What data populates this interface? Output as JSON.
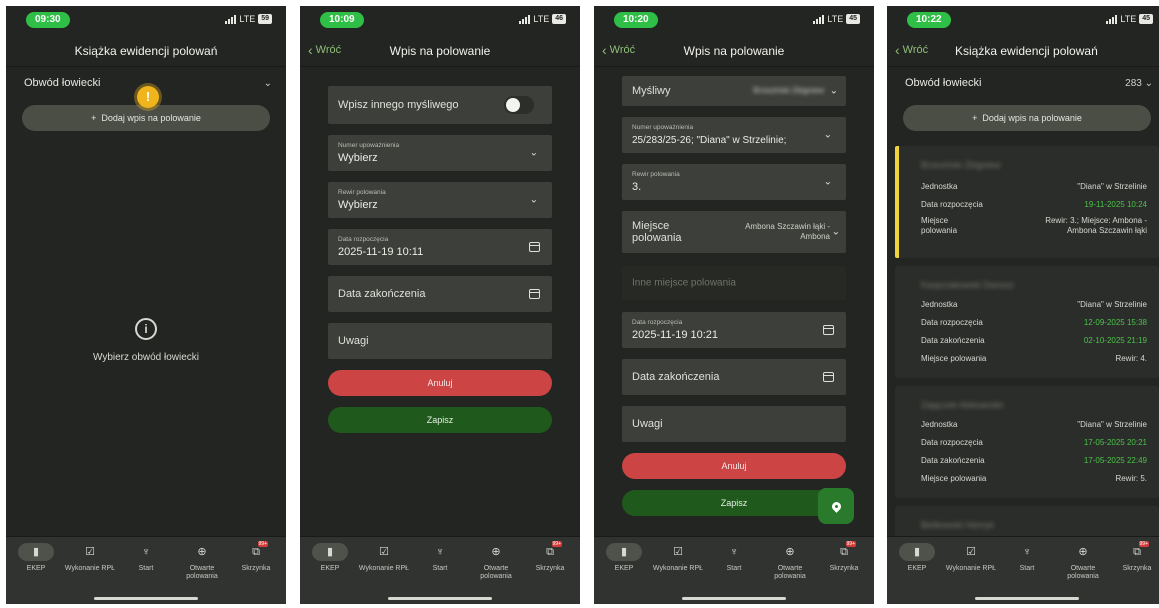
{
  "status": {
    "times": [
      "09:30",
      "10:09",
      "10:20",
      "10:22"
    ],
    "network": "LTE",
    "battery": [
      "59",
      "46",
      "45",
      "45"
    ]
  },
  "screen1": {
    "title": "Książka ewidencji polowań",
    "district_label": "Obwód łowiecki",
    "add_button": "Dodaj wpis na polowanie",
    "empty_text": "Wybierz obwód łowiecki"
  },
  "screen2": {
    "back_label": "Wróć",
    "title": "Wpis na polowanie",
    "other_hunter_label": "Wpisz innego myśliwego",
    "permit_label": "Numer upoważnienia",
    "permit_value": "Wybierz",
    "district_label": "Rewir polowania",
    "district_value": "Wybierz",
    "start_label": "Data rozpoczęcia",
    "start_value": "2025-11-19 10:11",
    "end_placeholder": "Data zakończenia",
    "notes_placeholder": "Uwagi",
    "cancel": "Anuluj",
    "save": "Zapisz"
  },
  "screen3": {
    "back_label": "Wróć",
    "title": "Wpis na polowanie",
    "hunter_label": "Myśliwy",
    "hunter_value": "Brzeziński Zbigniew",
    "permit_label": "Numer upoważnienia",
    "permit_value": "25/283/25-26; \"Diana\" w Strzelinie;",
    "district_label": "Rewir polowania",
    "district_value": "3.",
    "place_label": "Miejsce polowania",
    "place_value": "Ambona Szczawin łąki - Ambona",
    "other_place_placeholder": "Inne miejsce polowania",
    "start_label": "Data rozpoczęcia",
    "start_value": "2025-11-19 10:21",
    "end_placeholder": "Data zakończenia",
    "notes_placeholder": "Uwagi",
    "cancel": "Anuluj",
    "save": "Zapisz"
  },
  "screen4": {
    "back_label": "Wróć",
    "title": "Książka ewidencji polowań",
    "district_label": "Obwód łowiecki",
    "district_value": "283",
    "add_button": "Dodaj wpis na polowanie",
    "cards": [
      {
        "name": "Brzeziński Zbigniew",
        "unit_label": "Jednostka",
        "unit_value": "\"Diana\" w Strzelinie",
        "start_label": "Data rozpoczęcia",
        "start_value": "19-11-2025 10:24",
        "place_label_1": "Miejsce",
        "place_label_2": "polowania",
        "place_value_1": "Rewir: 3.; Miejsce: Ambona -",
        "place_value_2": "Ambona Szczawin łąki"
      },
      {
        "name": "Kasprzakowski Dariusz",
        "unit_label": "Jednostka",
        "unit_value": "\"Diana\" w Strzelinie",
        "start_label": "Data rozpoczęcia",
        "start_value": "12-09-2025 15:38",
        "end_label": "Data zakończenia",
        "end_value": "02-10-2025 21:19",
        "place_label": "Miejsce polowania",
        "place_value": "Rewir: 4."
      },
      {
        "name": "Zajączek Aleksander",
        "unit_label": "Jednostka",
        "unit_value": "\"Diana\" w Strzelinie",
        "start_label": "Data rozpoczęcia",
        "start_value": "17-05-2025 20:21",
        "end_label": "Data zakończenia",
        "end_value": "17-05-2025 22:49",
        "place_label": "Miejsce polowania",
        "place_value": "Rewir: 5."
      },
      {
        "name": "Bielkowski Henryk"
      }
    ]
  },
  "tabs": [
    {
      "label": "EKEP",
      "icon": "book-icon"
    },
    {
      "label": "Wykonanie RPŁ",
      "icon": "calendar-check-icon"
    },
    {
      "label": "Start",
      "icon": "deer-icon"
    },
    {
      "label": "Otwarte polowania",
      "icon": "crosshair-icon"
    },
    {
      "label": "Skrzynka",
      "icon": "inbox-icon",
      "badge": "99+"
    }
  ],
  "colors": {
    "background": "#232522",
    "accent_green": "#2fbf46",
    "save_green": "#1f5a1c",
    "cancel_red": "#cc4444",
    "highlight_yellow": "#f0d23a",
    "date_green": "#4cc24c"
  }
}
